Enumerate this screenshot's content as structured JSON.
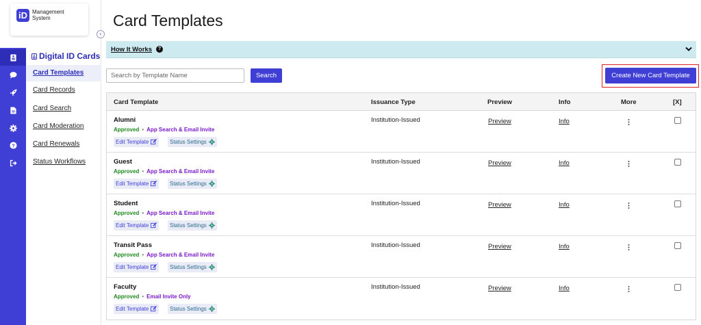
{
  "app": {
    "logo_letters": "iD",
    "logo_text": "Management System",
    "collapse_glyph": "‹"
  },
  "rail": {
    "items": [
      {
        "icon": "id-card-icon",
        "active": true
      },
      {
        "icon": "chat-bubble-icon",
        "active": false
      },
      {
        "icon": "rocket-icon",
        "active": false
      },
      {
        "icon": "document-icon",
        "active": false
      },
      {
        "icon": "gear-icon",
        "active": false
      },
      {
        "icon": "question-circle-icon",
        "active": false
      },
      {
        "icon": "sign-out-icon",
        "active": false
      }
    ]
  },
  "sidebar": {
    "section_title": "Digital ID Cards",
    "items": [
      {
        "label": "Card Templates",
        "active": true
      },
      {
        "label": "Card Records",
        "active": false
      },
      {
        "label": "Card Search",
        "active": false
      },
      {
        "label": "Card Moderation",
        "active": false
      },
      {
        "label": "Card Renewals",
        "active": false
      },
      {
        "label": "Status Workflows",
        "active": false
      }
    ]
  },
  "main": {
    "title": "Card Templates",
    "how_it_works": "How It Works",
    "search_placeholder": "Search by Template Name",
    "search_button": "Search",
    "create_button": "Create New Card Template"
  },
  "table": {
    "headers": {
      "template": "Card Template",
      "issuance": "Issuance Type",
      "preview": "Preview",
      "info": "Info",
      "more": "More",
      "select": "[X]"
    },
    "rows": [
      {
        "name": "Alumni",
        "status": "Approved",
        "mode": "App Search & Email Invite",
        "issuance": "Institution-Issued",
        "preview": "Preview",
        "info": "Info",
        "edit": "Edit Template",
        "status_settings": "Status Settings"
      },
      {
        "name": "Guest",
        "status": "Approved",
        "mode": "App Search & Email Invite",
        "issuance": "Institution-Issued",
        "preview": "Preview",
        "info": "Info",
        "edit": "Edit Template",
        "status_settings": "Status Settings"
      },
      {
        "name": "Student",
        "status": "Approved",
        "mode": "App Search & Email Invite",
        "issuance": "Institution-Issued",
        "preview": "Preview",
        "info": "Info",
        "edit": "Edit Template",
        "status_settings": "Status Settings"
      },
      {
        "name": "Transit Pass",
        "status": "Approved",
        "mode": "App Search & Email Invite",
        "issuance": "Institution-Issued",
        "preview": "Preview",
        "info": "Info",
        "edit": "Edit Template",
        "status_settings": "Status Settings"
      },
      {
        "name": "Faculty",
        "status": "Approved",
        "mode": "Email Invite Only",
        "issuance": "Institution-Issued",
        "preview": "Preview",
        "info": "Info",
        "edit": "Edit Template",
        "status_settings": "Status Settings"
      }
    ]
  },
  "colors": {
    "primary": "#3f3fd6",
    "approved": "#1f8a1f",
    "mode": "#7a18c9",
    "info_bar": "#cdeaf1",
    "highlight_outline": "#e02020"
  }
}
